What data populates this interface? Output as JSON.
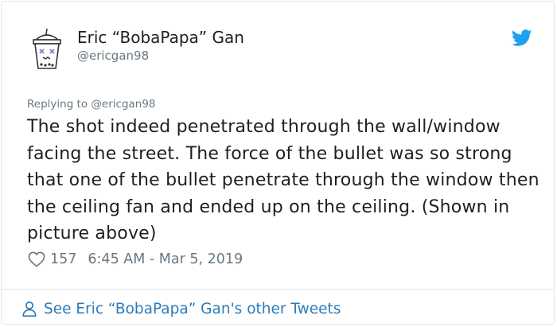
{
  "author": {
    "display_name": "Eric “BobaPapa” Gan",
    "handle": "@ericgan98"
  },
  "tweet": {
    "reply_prefix": "Replying to ",
    "reply_handle": "@ericgan98",
    "text": "The shot indeed penetrated through the wall/window facing the street. The force of the bullet was so strong that one of the bullet penetrate through the window then the ceiling fan and ended up on the ceiling. (Shown in picture above)",
    "likes": "157",
    "timestamp": "6:45 AM - Mar 5, 2019"
  },
  "footer": {
    "link_text": "See Eric “BobaPapa” Gan's other Tweets"
  },
  "colors": {
    "twitter_blue": "#1da1f2",
    "link_blue": "#2b7bb9",
    "secondary_text": "#697882",
    "border": "#e1e8ed"
  },
  "icons": {
    "brand": "twitter-bird-icon",
    "like": "heart-icon",
    "profile": "person-icon"
  }
}
